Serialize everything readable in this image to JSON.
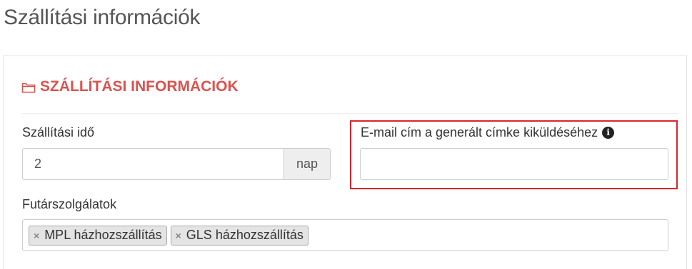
{
  "page": {
    "title": "Szállítási információk"
  },
  "section": {
    "heading": "SZÁLLÍTÁSI INFORMÁCIÓK",
    "icon": "folder-icon",
    "accent_color": "#d9534f"
  },
  "delivery_time": {
    "label": "Szállítási idő",
    "value": "2",
    "addon": "nap"
  },
  "email_label_field": {
    "label": "E-mail cím a generált címke kiküldéséhez",
    "info_icon": "info-icon",
    "info_glyph": "i",
    "value": "",
    "highlight_color": "#d9252b"
  },
  "couriers": {
    "label": "Futárszolgálatok",
    "remove_glyph": "×",
    "selected": [
      {
        "label": "MPL házhozszállítás"
      },
      {
        "label": "GLS házhozszállítás"
      }
    ]
  }
}
